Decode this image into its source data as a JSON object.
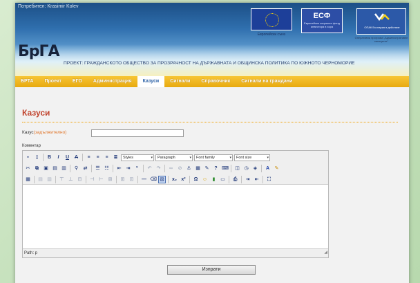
{
  "header": {
    "user_line": "Потребител: Krasimir Kolev",
    "eu_caption": "Европейски съюз",
    "esf_title": "ЕСФ",
    "esf_subtitle": "Европейски социален фонд инвестира в хора",
    "op_subtitle": "ОПАК България в действие",
    "op_caption": "Оперативна програма „Административен капацитет“",
    "logo": "БрГА",
    "project_title": "ПРОЕКТ: ГРАЖДАНСКОТО ОБЩЕСТВО ЗА ПРОЗРАЧНОСТ НА ДЪРЖАВНАТА И ОБЩИНСКА ПОЛИТИКА ПО ЮЖНОТО ЧЕРНОМОРИЕ"
  },
  "nav": {
    "items": [
      {
        "label": "БРТА"
      },
      {
        "label": "Проект"
      },
      {
        "label": "ЕГО"
      },
      {
        "label": "Администрация"
      },
      {
        "label": "Казуси",
        "active": true
      },
      {
        "label": "Сигнали"
      },
      {
        "label": "Справочник"
      },
      {
        "label": "Сигнали на граждани"
      }
    ]
  },
  "form": {
    "title": "Казуси",
    "case_label": "Казус",
    "case_required": "(задължително)",
    "case_value": "",
    "comment_label": "Коментар",
    "styles_select": "Styles",
    "format_select": "Paragraph",
    "font_family_select": "Font family",
    "font_size_select": "Font size",
    "path": "Path: p",
    "submit_label": "Изпрати"
  },
  "colors": {
    "nav_bg": "#e8a90f",
    "title": "#c0432d",
    "required": "#e0762b"
  }
}
